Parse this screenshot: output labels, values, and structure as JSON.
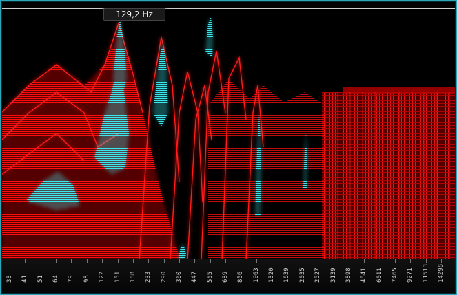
{
  "readout": {
    "frequency": "129,2 Hz"
  },
  "axis": {
    "ticks": [
      "33",
      "41",
      "51",
      "64",
      "79",
      "98",
      "122",
      "151",
      "188",
      "233",
      "290",
      "360",
      "447",
      "555",
      "689",
      "856",
      "1063",
      "1320",
      "1639",
      "2035",
      "2527",
      "3139",
      "3898",
      "4841",
      "6011",
      "7465",
      "9271",
      "11513",
      "14298"
    ]
  },
  "colors": {
    "frame": "#2aa7b8",
    "spectrum": "#ff1a1a",
    "peak": "#38e6ee",
    "background": "#000000"
  }
}
